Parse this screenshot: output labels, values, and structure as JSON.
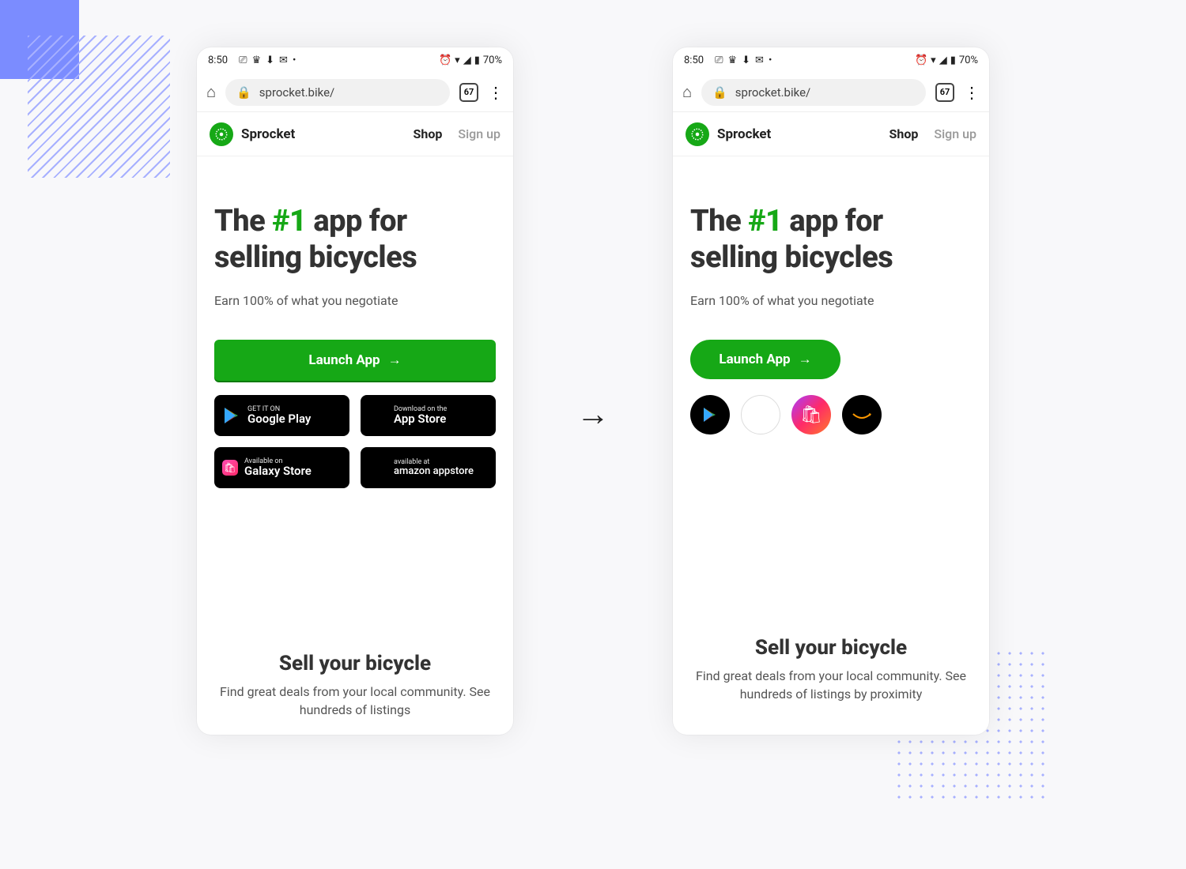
{
  "statusbar": {
    "time": "8:50",
    "battery": "70%"
  },
  "urlbar": {
    "url": "sprocket.bike/",
    "tabs": "67"
  },
  "header": {
    "brand": "Sprocket",
    "shop": "Shop",
    "signup": "Sign up"
  },
  "hero": {
    "h1_pre": "The ",
    "h1_accent": "#1",
    "h1_post": " app for selling bicycles",
    "sub": "Earn 100% of what you negotiate"
  },
  "launch": "Launch App",
  "badges": {
    "play_top": "GET IT ON",
    "play_bot": "Google Play",
    "apple_top": "Download on the",
    "apple_bot": "App Store",
    "galaxy_top": "Available on",
    "galaxy_bot": "Galaxy Store",
    "amazon_top": "available at",
    "amazon_bot": "amazon appstore"
  },
  "section2_a": {
    "title": "Sell your bicycle",
    "body": "Find great deals from your local community. See hundreds of listings"
  },
  "section2_b": {
    "title": "Sell your bicycle",
    "body": "Find great deals from your local community. See hundreds of listings by proximity"
  }
}
